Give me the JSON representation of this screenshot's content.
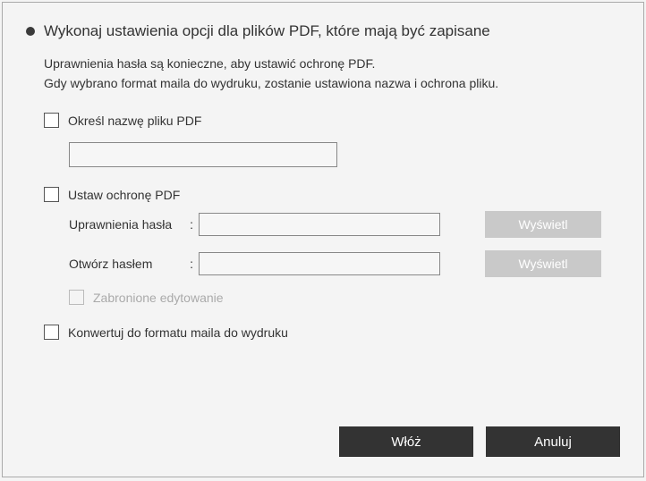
{
  "title": "Wykonaj ustawienia opcji dla plików PDF, które mają być zapisane",
  "description": {
    "line1": "Uprawnienia hasła są konieczne, aby ustawić ochronę PDF.",
    "line2": "Gdy wybrano format maila do wydruku, zostanie ustawiona nazwa i ochrona pliku."
  },
  "options": {
    "specify_filename": {
      "label": "Określ nazwę pliku PDF",
      "value": ""
    },
    "set_protection": {
      "label": "Ustaw ochronę PDF",
      "permissions_label": "Uprawnienia hasła",
      "permissions_value": "",
      "open_label": "Otwórz hasłem",
      "open_value": "",
      "show_button": "Wyświetl",
      "prohibit_editing": "Zabronione edytowanie"
    },
    "convert_mail": {
      "label": "Konwertuj do formatu maila do wydruku"
    }
  },
  "buttons": {
    "insert": "Włóż",
    "cancel": "Anuluj"
  }
}
